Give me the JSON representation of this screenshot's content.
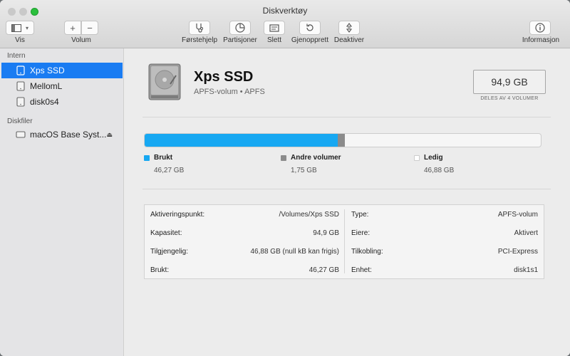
{
  "window": {
    "title": "Diskverktøy"
  },
  "toolbar": {
    "view_label": "Vis",
    "volume_label": "Volum",
    "volume_add": "+",
    "volume_remove": "−",
    "first_aid": "Førstehjelp",
    "partition": "Partisjoner",
    "erase": "Slett",
    "restore": "Gjenopprett",
    "unmount": "Deaktiver",
    "info": "Informasjon"
  },
  "sidebar": {
    "sections": [
      {
        "title": "Intern",
        "items": [
          {
            "label": "Xps SSD",
            "selected": true
          },
          {
            "label": "MellomL",
            "selected": false
          },
          {
            "label": "disk0s4",
            "selected": false
          }
        ]
      },
      {
        "title": "Diskfiler",
        "items": [
          {
            "label": "macOS Base Syst...",
            "selected": false,
            "eject": "⏏"
          }
        ]
      }
    ]
  },
  "volume": {
    "name": "Xps SSD",
    "subtitle": "APFS-volum • APFS",
    "capacity": "94,9 GB",
    "capacity_note": "DELES AV 4 VOLUMER"
  },
  "usage": {
    "used_fraction": 0.4876,
    "other_fraction": 0.0184,
    "colors": {
      "used": "#17a8f2",
      "other": "#8b8b8b",
      "free": "#f6f6f6"
    },
    "legend": [
      {
        "name": "Brukt",
        "value": "46,27 GB",
        "color": "#17a8f2"
      },
      {
        "name": "Andre volumer",
        "value": "1,75 GB",
        "color": "#8b8b8b"
      },
      {
        "name": "Ledig",
        "value": "46,88 GB",
        "color": "#ffffff"
      }
    ]
  },
  "info": {
    "left": [
      {
        "key": "Aktiveringspunkt:",
        "value": "/Volumes/Xps SSD"
      },
      {
        "key": "Kapasitet:",
        "value": "94,9 GB"
      },
      {
        "key": "Tilgjengelig:",
        "value": "46,88 GB (null kB kan frigis)"
      },
      {
        "key": "Brukt:",
        "value": "46,27 GB"
      }
    ],
    "right": [
      {
        "key": "Type:",
        "value": "APFS-volum"
      },
      {
        "key": "Eiere:",
        "value": "Aktivert"
      },
      {
        "key": "Tilkobling:",
        "value": "PCI-Express"
      },
      {
        "key": "Enhet:",
        "value": "disk1s1"
      }
    ]
  }
}
